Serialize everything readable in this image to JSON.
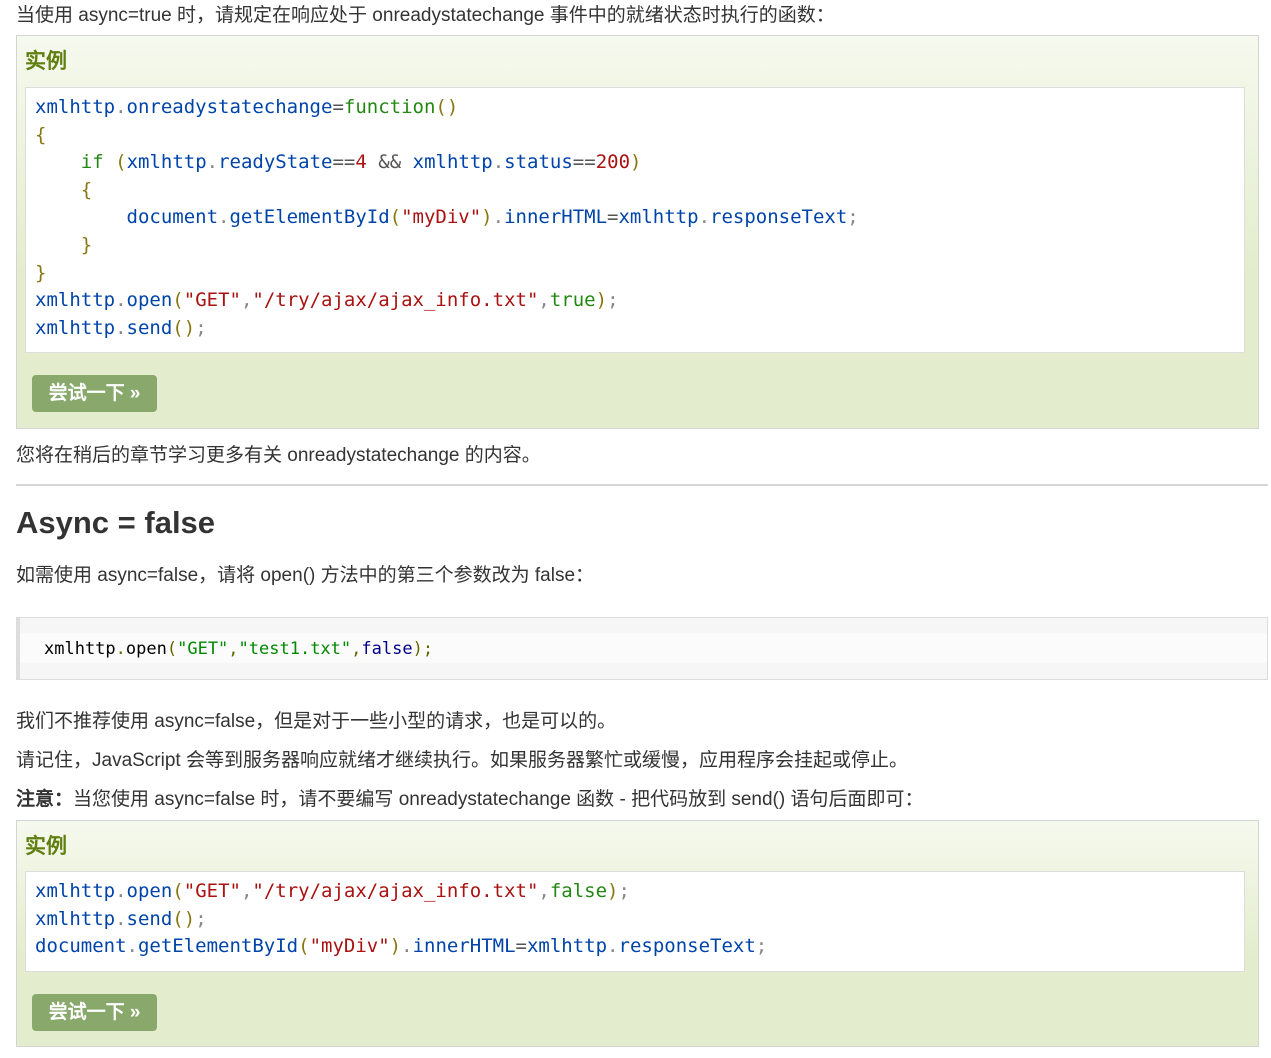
{
  "intro": {
    "text": "当使用 async=true 时，请规定在响应处于 onreadystatechange 事件中的就绪状态时执行的函数："
  },
  "example1": {
    "title": "实例",
    "code_lines": [
      "xmlhttp.onreadystatechange=function()",
      "{",
      "    if (xmlhttp.readyState==4 && xmlhttp.status==200)",
      "    {",
      "        document.getElementById(\"myDiv\").innerHTML=xmlhttp.responseText;",
      "    }",
      "}",
      "xmlhttp.open(\"GET\",\"/try/ajax/ajax_info.txt\",true);",
      "xmlhttp.send();"
    ],
    "button_label": "尝试一下 »"
  },
  "after_example1": {
    "text": "您将在稍后的章节学习更多有关 onreadystatechange 的内容。"
  },
  "section": {
    "heading": "Async = false",
    "intro": "如需使用 async=false，请将 open() 方法中的第三个参数改为 false：",
    "snippet": "xmlhttp.open(\"GET\",\"test1.txt\",false);",
    "para1": "我们不推荐使用 async=false，但是对于一些小型的请求，也是可以的。",
    "para2": "请记住，JavaScript 会等到服务器响应就绪才继续执行。如果服务器繁忙或缓慢，应用程序会挂起或停止。",
    "note_label": "注意：",
    "note_text": "当您使用 async=false 时，请不要编写 onreadystatechange 函数 - 把代码放到 send() 语句后面即可："
  },
  "example2": {
    "title": "实例",
    "code_lines": [
      "xmlhttp.open(\"GET\",\"/try/ajax/ajax_info.txt\",false);",
      "xmlhttp.send();",
      "document.getElementById(\"myDiv\").innerHTML=xmlhttp.responseText;"
    ],
    "button_label": "尝试一下 »"
  },
  "colors": {
    "example_title": "#617f10",
    "button_bg": "#88a86c",
    "example_bg": "#e3edcd"
  }
}
